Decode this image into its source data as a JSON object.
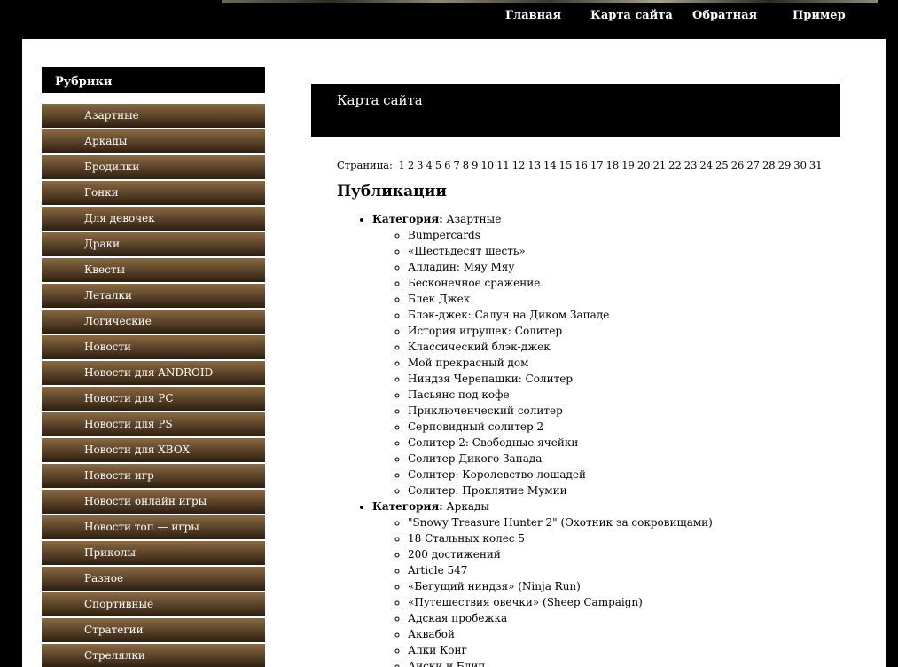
{
  "nav": {
    "items": [
      {
        "label": "Главная"
      },
      {
        "label": "Карта сайта"
      },
      {
        "label": "Обратная"
      },
      {
        "label": "Пример"
      }
    ]
  },
  "sidebar": {
    "title": "Рубрики",
    "items": [
      "Азартные",
      "Аркады",
      "Бродилки",
      "Гонки",
      "Для девочек",
      "Драки",
      "Квесты",
      "Леталки",
      "Логические",
      "Новости",
      "Новости для ANDROID",
      "Новости для PC",
      "Новости для PS",
      "Новости для XBOX",
      "Новости игр",
      "Новости онлайн игры",
      "Новости топ — игры",
      "Приколы",
      "Разное",
      "Спортивные",
      "Стратегии",
      "Стрелялки"
    ]
  },
  "content": {
    "title": "Карта сайта",
    "pagination_label": "Страница:",
    "pages": [
      "1",
      "2",
      "3",
      "4",
      "5",
      "6",
      "7",
      "8",
      "9",
      "10",
      "11",
      "12",
      "13",
      "14",
      "15",
      "16",
      "17",
      "18",
      "19",
      "20",
      "21",
      "22",
      "23",
      "24",
      "25",
      "26",
      "27",
      "28",
      "29",
      "30",
      "31"
    ],
    "section_title": "Публикации",
    "category_prefix": "Категория:",
    "categories": [
      {
        "name": "Азартные",
        "posts": [
          "Bumpercards",
          "«Шестьдесят шесть»",
          "Алладин: Мяу Мяу",
          "Бесконечное сражение",
          "Блек Джек",
          "Блэк-джек: Салун на Диком Западе",
          "История игрушек: Солитер",
          "Классический блэк-джек",
          "Мой прекрасный дом",
          "Ниндзя Черепашки: Солитер",
          "Пасьянс под кофе",
          "Приключенческий солитер",
          "Серповидный солитер 2",
          "Солитер 2: Свободные ячейки",
          "Солитер Дикого Запада",
          "Солитер: Королевство лошадей",
          "Солитер: Проклятие Мумии"
        ]
      },
      {
        "name": "Аркады",
        "posts": [
          "\"Snowy Treasure Hunter 2\" (Охотник за сокровищами)",
          "18 Стальных колес 5",
          "200 достижений",
          "Article 547",
          "«Бегущий ниндзя» (Ninja Run)",
          "«Путешествия овечки» (Sheep Campaign)",
          "Адская пробежка",
          "Аквабой",
          "Алки Конг",
          "Аиски и Блип"
        ]
      }
    ]
  }
}
